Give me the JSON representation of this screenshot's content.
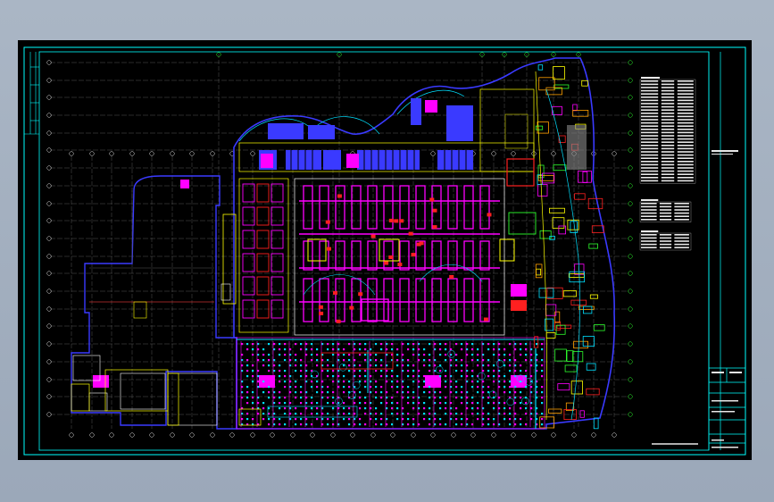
{
  "drawing": {
    "background": "#000000",
    "frame_color": "#00ffff",
    "palette": {
      "grid": "#e8e8e8",
      "wall_blue": "#3a3aff",
      "cyan": "#00e0ff",
      "magenta": "#ff00ff",
      "yellow": "#ffff00",
      "green": "#2dff2d",
      "red": "#ff2020",
      "orange": "#ffa000"
    },
    "legend_rows_main": 32,
    "legend_rows_mid": 6,
    "legend_rows_low": 5
  }
}
